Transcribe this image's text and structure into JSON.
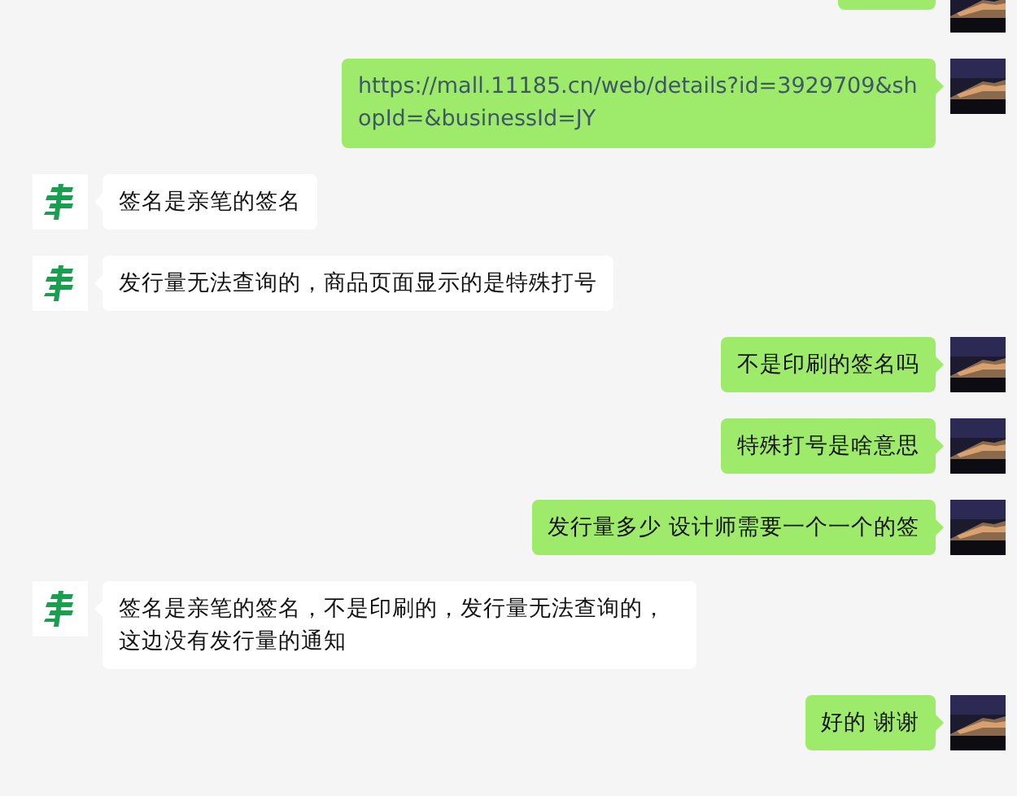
{
  "messages": [
    {
      "from_me": true,
      "cropped": true
    },
    {
      "from_me": true,
      "kind": "link",
      "text": "https://mall.11185.cn/web/details?id=3929709&shopId=&businessId=JY"
    },
    {
      "from_me": false,
      "kind": "text",
      "text": "签名是亲笔的签名"
    },
    {
      "from_me": false,
      "kind": "text",
      "text": "发行量无法查询的，商品页面显示的是特殊打号"
    },
    {
      "from_me": true,
      "kind": "text",
      "text": "不是印刷的签名吗"
    },
    {
      "from_me": true,
      "kind": "text",
      "text": "特殊打号是啥意思"
    },
    {
      "from_me": true,
      "kind": "text",
      "text": "发行量多少 设计师需要一个一个的签"
    },
    {
      "from_me": false,
      "kind": "text",
      "text": "签名是亲笔的签名，不是印刷的，发行量无法查询的，这边没有发行量的通知"
    },
    {
      "from_me": true,
      "kind": "text",
      "text": "好的 谢谢"
    }
  ]
}
